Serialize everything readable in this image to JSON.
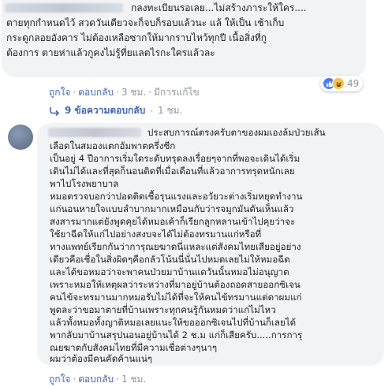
{
  "comment1": {
    "lines": [
      "กลงทะเบียนรอเลย...ไม่สร้างภาระให้ใคร....",
      "ตายทุกกำหนดไว้ สวดวันเดียวจะก็จบก็รอบแล้วนะ แล้ ให้เป็น เช้าเก็บ",
      "กระดูกลอยอังคาร ไม่ต้องเหลือซากให้มากราบไหว้ทุกปี เนื้อสิ่งที่กู",
      "ต้องการ ตายห่าแล้วกูคงไม่รู้ที่ยแลตไรกะใครแล้วละ"
    ],
    "actions": {
      "like": "ถูกใจ",
      "reply": "ตอบกลับ",
      "time": "3 ชม.",
      "edited": "มีการแก้ไข"
    },
    "reaction_count": "49"
  },
  "replies_link": {
    "label": "9 ข้อความตอบกลับ",
    "time": "1 ชม."
  },
  "comment2": {
    "lines": [
      "ประสบการณ์ตรงครับตาของผมเองล้มป่วยเส้น",
      "เลือดในสมองแตกอัมพาตครึ่งซีก",
      "เป็นอยู่ 4 ปีอาการเริ่มใดระดับทรุดลงเรื่อยๆจากที่พอจะเดินได้เริ่ม",
      "เดินไม่ได้และที่สุดก็นอนติดที่เมื่อเดือนที่แล้วอาการทรุดหนักเลย",
      "พาไปโรงพยาบาล",
      "หมอตรวจบอกว่าปอดติดเชื้อรุนแรงและอวัยวะต่างเริ่มหยุดทำงาน",
      "แก่นอนหายใจแบบลำบากมากเหมือนกับว่ารจมูกมันดันเห็นแล้ว",
      "สงสารมากแต่ยังพูดคุยได้หมอเค้าก็เรียกลูกหลานเข้าไปคุยว่าจะ",
      "ใช้ยาฉีดให้แก่ไปอย่างสงบจะได้ไม่ต้องทรมานแก่หรือที่",
      "ทางแพทย์เรียกกันว่าการุณยฆาตนี่แหละแต่สังคมไทยเสียอยู่อย่าง",
      "เดียวคือเชื่อในสิ่งผิดๆคือกลัวโน้นนี่นั่นไปหมดเลยไม่ให้หมอฉีด",
      "และได้ขอหมอว่าจะพาคนป่วยมาบ้านแดวันนั้นหมอไม่อนุญาต",
      "เพราะหมอให้เหตุผลว่าระหว่างที่มาอยู่บ้านต้องถอดสายออกซิเจน",
      "คนไข้จะทรมานมากหมอรับไม่ได้ที่จะให้คนไข้ทรมานแต่ดาผมแก่",
      "พูดละว่าขอมาตายที่บ้านเพราะทุกคนรู้กันหมดว่าแก่ไม่ไหว",
      "แล้วทั้งหมอทั้งญาติหมอเลยแนะให้ขอออกซิเจนไปที่บ้านก็เลยได้",
      "พากลับมาบ้านสรุปนอนอยู่บ้านได้ 2 ช.ม แก่ก็เสียครับ.....การการุ",
      "ณยฆาตกับสังคมไทยที่มีความเชื่อต่างๆนาๆ",
      "ผมว่าต้องมีคนคัดค้านแน่ๆ"
    ],
    "actions": {
      "like": "ถูกใจ",
      "reply": "ตอบกลับ",
      "time": "1 ชม."
    }
  }
}
